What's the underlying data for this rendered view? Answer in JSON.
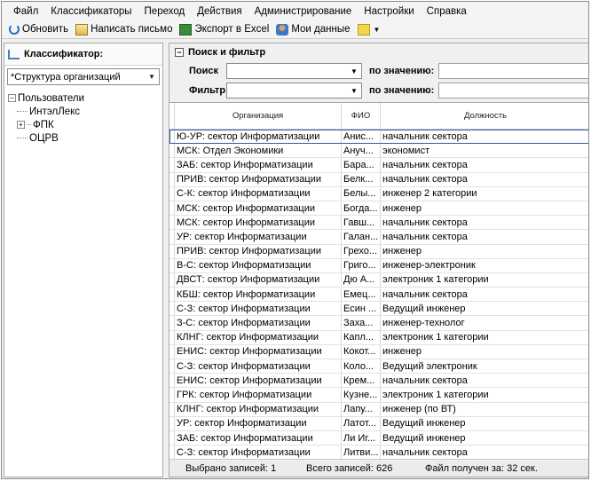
{
  "menu": [
    "Файл",
    "Классификаторы",
    "Переход",
    "Действия",
    "Администрирование",
    "Настройки",
    "Справка"
  ],
  "toolbar": {
    "refresh": "Обновить",
    "write_letter": "Написать письмо",
    "export_excel": "Экспорт в Excel",
    "my_data": "Мои данные"
  },
  "left": {
    "header": "Классификатор:",
    "combo_value": "*Структура организаций",
    "tree": [
      {
        "label": "Пользователи",
        "level": 0,
        "expander": "−"
      },
      {
        "label": "ИнтэлЛекс",
        "level": 1,
        "expander": ""
      },
      {
        "label": "ФПК",
        "level": 1,
        "expander": "+"
      },
      {
        "label": "ОЦРВ",
        "level": 1,
        "expander": ""
      }
    ]
  },
  "filter": {
    "title": "Поиск и фильтр",
    "search_label": "Поиск",
    "filter_label": "Фильтр",
    "by_value_label": "по значению:"
  },
  "grid": {
    "headers": {
      "org": "Организация",
      "fio": "ФИО",
      "position": "Должность"
    },
    "rows": [
      {
        "org": "Ю-УР: сектор Информатизации",
        "fio": "Анис...",
        "position": "начальник сектора",
        "selected": true
      },
      {
        "org": "МСК: Отдел Экономики",
        "fio": "Ануч...",
        "position": "экономист"
      },
      {
        "org": "ЗАБ: сектор Информатизации",
        "fio": "Бара...",
        "position": "начальник сектора"
      },
      {
        "org": "ПРИВ: сектор Информатизации",
        "fio": "Белк...",
        "position": "начальник сектора"
      },
      {
        "org": "С-К: сектор Информатизации",
        "fio": "Белы...",
        "position": "инженер 2 категории"
      },
      {
        "org": "МСК: сектор Информатизации",
        "fio": "Богда...",
        "position": "инженер"
      },
      {
        "org": "МСК: сектор Информатизации",
        "fio": "Гавш...",
        "position": "начальник сектора"
      },
      {
        "org": "УР: сектор Информатизации",
        "fio": "Галан...",
        "position": "начальник сектора"
      },
      {
        "org": "ПРИВ: сектор Информатизации",
        "fio": "Грехо...",
        "position": "инженер"
      },
      {
        "org": "В-С: сектор Информатизации",
        "fio": "Григо...",
        "position": "инженер-электроник"
      },
      {
        "org": "ДВСТ: сектор Информатизации",
        "fio": "Дю А...",
        "position": "электроник 1 категории"
      },
      {
        "org": "КБШ: сектор Информатизации",
        "fio": "Емец...",
        "position": "начальник сектора"
      },
      {
        "org": "С-З: сектор Информатизации",
        "fio": "Есин ...",
        "position": "Ведущий инженер"
      },
      {
        "org": "З-С: сектор Информатизации",
        "fio": "Заха...",
        "position": "инженер-технолог"
      },
      {
        "org": "КЛНГ: сектор Информатизации",
        "fio": "Капл...",
        "position": "электроник 1 категории"
      },
      {
        "org": "ЕНИС: сектор Информатизации",
        "fio": "Кокот...",
        "position": "инженер"
      },
      {
        "org": "С-З: сектор Информатизации",
        "fio": "Коло...",
        "position": "Ведущий электроник"
      },
      {
        "org": "ЕНИС: сектор Информатизации",
        "fio": "Крем...",
        "position": "начальник сектора"
      },
      {
        "org": "ГРК: сектор Информатизации",
        "fio": "Кузне...",
        "position": "электроник 1 категории"
      },
      {
        "org": "КЛНГ: сектор Информатизации",
        "fio": "Лапу...",
        "position": "инженер (по ВТ)"
      },
      {
        "org": "УР: сектор Информатизации",
        "fio": "Латот...",
        "position": "Ведущий инженер"
      },
      {
        "org": "ЗАБ: сектор Информатизации",
        "fio": "Ли Иг...",
        "position": "Ведущий инженер"
      },
      {
        "org": "С-З: сектор Информатизации",
        "fio": "Литви...",
        "position": "начальник сектора"
      }
    ]
  },
  "status": {
    "selected": "Выбрано записей: 1",
    "total": "Всего записей: 626",
    "time": "Файл получен за:  32 сек."
  }
}
